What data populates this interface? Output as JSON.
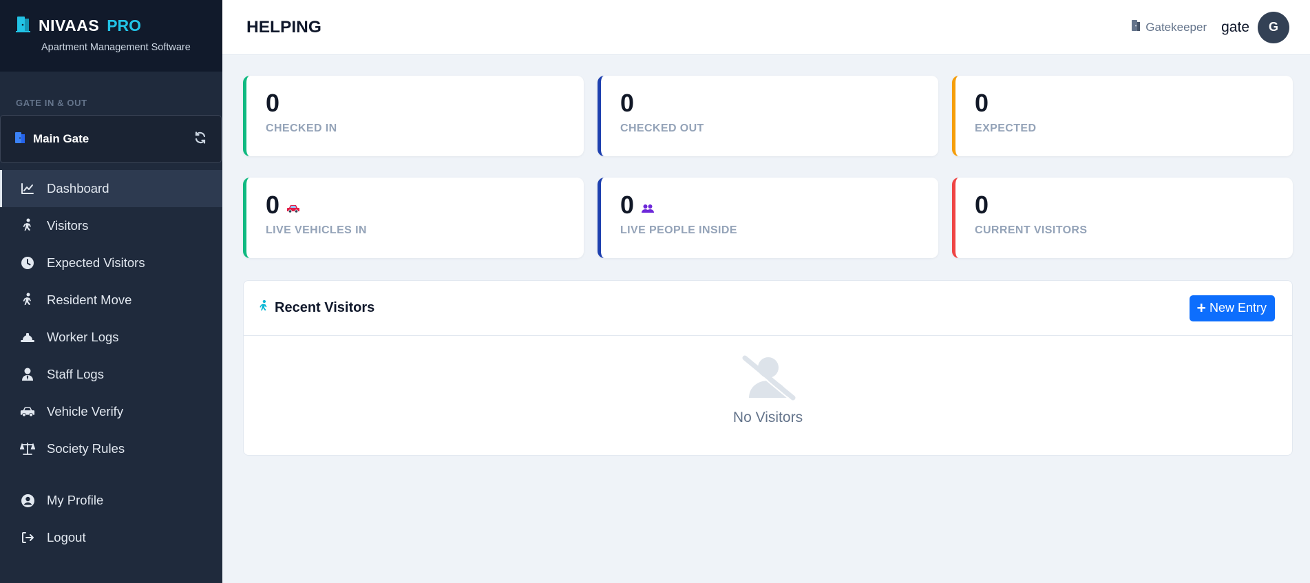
{
  "brand": {
    "name": "NIVAAS",
    "pro": "PRO",
    "tagline": "Apartment Management Software"
  },
  "sidebar": {
    "section_label": "GATE IN & OUT",
    "gate": "Main Gate",
    "items": [
      {
        "label": "Dashboard",
        "icon": "chart-line-icon",
        "active": true
      },
      {
        "label": "Visitors",
        "icon": "walking-icon"
      },
      {
        "label": "Expected Visitors",
        "icon": "clock-icon"
      },
      {
        "label": "Resident Move",
        "icon": "walking-icon"
      },
      {
        "label": "Worker Logs",
        "icon": "hard-hat-icon"
      },
      {
        "label": "Staff Logs",
        "icon": "user-tie-icon"
      },
      {
        "label": "Vehicle Verify",
        "icon": "car-icon"
      },
      {
        "label": "Society Rules",
        "icon": "balance-scale-icon"
      }
    ],
    "bottom_items": [
      {
        "label": "My Profile",
        "icon": "user-circle-icon"
      },
      {
        "label": "Logout",
        "icon": "sign-out-icon"
      }
    ]
  },
  "header": {
    "title": "HELPING",
    "role": "Gatekeeper",
    "username": "gate",
    "avatar_initial": "G"
  },
  "stats": [
    {
      "value": "0",
      "label": "CHECKED IN",
      "color": "#10b981"
    },
    {
      "value": "0",
      "label": "CHECKED OUT",
      "color": "#1e40af"
    },
    {
      "value": "0",
      "label": "EXPECTED",
      "color": "#f59e0b"
    },
    {
      "value": "0",
      "label": "LIVE VEHICLES IN",
      "color": "#10b981",
      "icon": "car-icon"
    },
    {
      "value": "0",
      "label": "LIVE PEOPLE INSIDE",
      "color": "#1e40af",
      "icon": "users-icon"
    },
    {
      "value": "0",
      "label": "CURRENT VISITORS",
      "color": "#ef4444"
    }
  ],
  "recent": {
    "title": "Recent Visitors",
    "new_entry_label": "New Entry",
    "empty_text": "No Visitors"
  },
  "colors": {
    "sidebar": "#1f2a3c",
    "brand_bg": "#111a2b",
    "accent": "#22c3e6",
    "primary_button": "#0d6efd",
    "page_bg": "#eff3f8"
  }
}
